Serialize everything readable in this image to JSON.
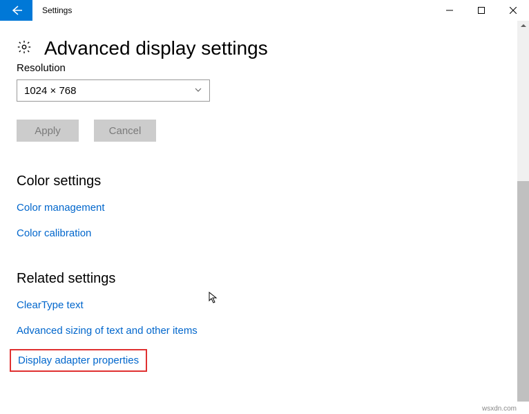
{
  "window": {
    "title": "Settings"
  },
  "page": {
    "title": "Advanced display settings"
  },
  "resolution": {
    "label": "Resolution",
    "value": "1024 × 768",
    "apply": "Apply",
    "cancel": "Cancel"
  },
  "color_settings": {
    "heading": "Color settings",
    "links": {
      "management": "Color management",
      "calibration": "Color calibration"
    }
  },
  "related_settings": {
    "heading": "Related settings",
    "links": {
      "cleartype": "ClearType text",
      "sizing": "Advanced sizing of text and other items",
      "adapter": "Display adapter properties"
    }
  },
  "watermark": "wsxdn.com"
}
